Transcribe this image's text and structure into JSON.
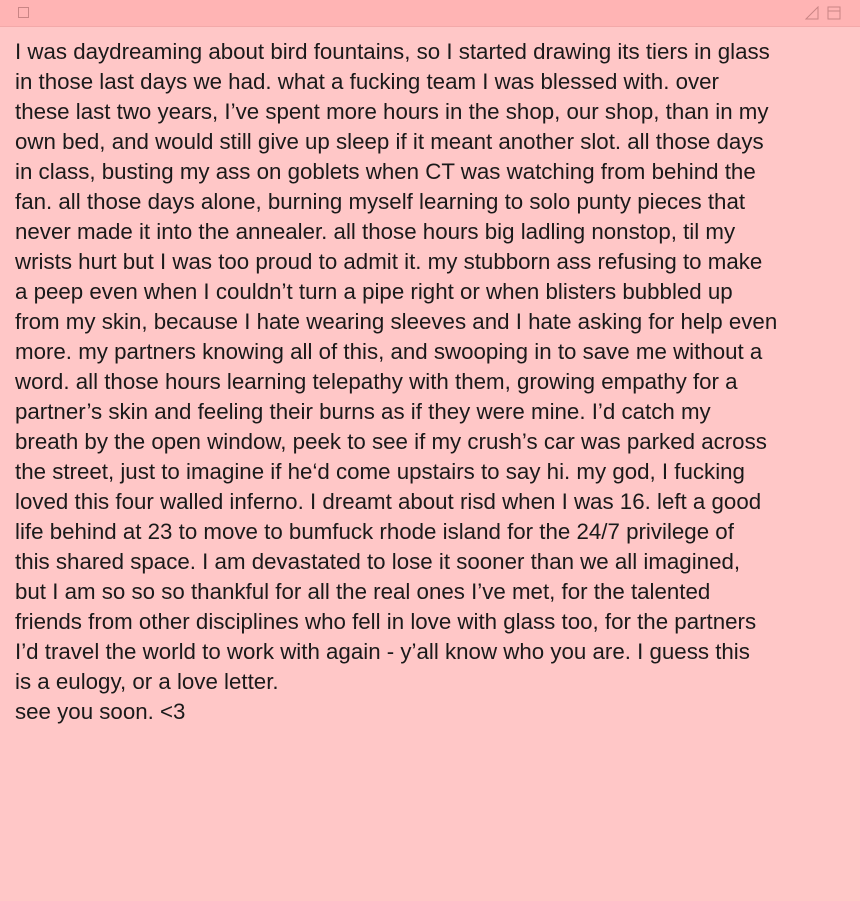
{
  "note": {
    "body": "I was daydreaming about bird fountains, so I started drawing its tiers in glass\nin those last days we had. what a fucking team I was blessed with. over\nthese last two years, I’ve spent more hours in the shop, our shop, than in my\nown bed, and would still give up sleep if it meant another slot. all those days\nin class, busting my ass on goblets when CT was watching from behind the\nfan. all those days alone, burning myself learning to solo punty pieces that\nnever made it into the annealer. all those hours big ladling nonstop, til my\nwrists hurt but I was too proud to admit it. my stubborn ass refusing to make\na peep even when I couldn’t turn a pipe right or when blisters bubbled up\nfrom my skin, because I hate wearing sleeves and I hate asking for help even\nmore. my partners knowing all of this, and swooping in to save me without a\nword. all those hours learning telepathy with them, growing empathy for a\npartner’s skin and feeling their burns as if they were mine. I’d catch my\nbreath by the open window, peek to see if my crush’s car was parked across\nthe street, just to imagine if he‘d come upstairs to say hi. my god, I fucking\nloved this four walled inferno. I dreamt about risd when I was 16. left a good\nlife behind at 23 to move to bumfuck rhode island for the 24/7 privilege of\nthis shared space. I am devastated to lose it sooner than we all imagined,\nbut I am so so so thankful for all the real ones I’ve met, for the talented\nfriends from other disciplines who fell in love with glass too, for the partners\nI’d travel the world to work with again - y’all know who you are. I guess this\nis a eulogy, or a love letter.\nsee you soon. <3"
  },
  "colors": {
    "background": "#ffc7c7",
    "titlebar": "#ffb4b4",
    "text": "#1a1a1a",
    "spellcheck": "#e87878"
  },
  "icons": {
    "close": "close-box-icon",
    "resize": "resize-corner-icon",
    "collapse": "collapse-window-icon"
  }
}
